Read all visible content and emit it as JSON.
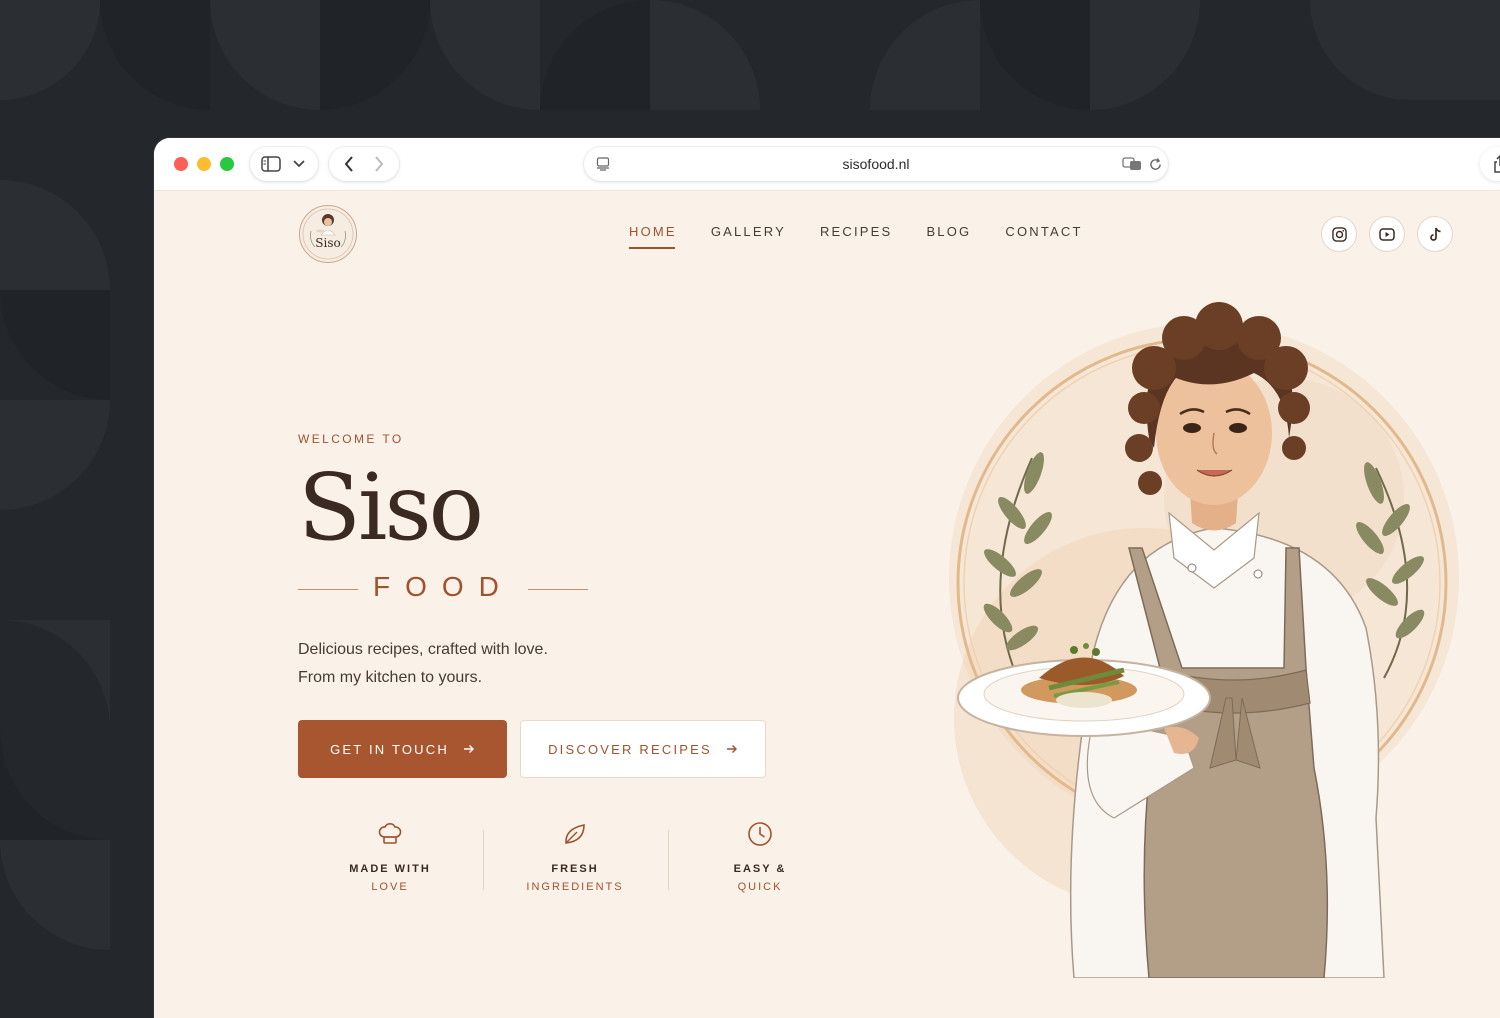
{
  "browser": {
    "url": "sisofood.nl"
  },
  "site": {
    "logo_text": "Siso",
    "nav": [
      {
        "label": "HOME",
        "active": true
      },
      {
        "label": "GALLERY",
        "active": false
      },
      {
        "label": "RECIPES",
        "active": false
      },
      {
        "label": "BLOG",
        "active": false
      },
      {
        "label": "CONTACT",
        "active": false
      }
    ],
    "social": [
      "instagram-icon",
      "youtube-icon",
      "tiktok-icon"
    ]
  },
  "hero": {
    "welcome": "WELCOME TO",
    "brand": "Siso",
    "subbrand": "FOOD",
    "tagline_1": "Delicious recipes, crafted with love.",
    "tagline_2": "From my kitchen to yours.",
    "primary_button": "GET IN TOUCH",
    "secondary_button": "DISCOVER RECIPES"
  },
  "features": [
    {
      "icon": "chef-hat-icon",
      "title": "MADE WITH",
      "sub": "LOVE"
    },
    {
      "icon": "leaf-icon",
      "title": "FRESH",
      "sub": "INGREDIENTS"
    },
    {
      "icon": "clock-icon",
      "title": "EASY &",
      "sub": "QUICK"
    }
  ],
  "colors": {
    "accent": "#a8562f",
    "page_bg": "#faf2e8",
    "text_dark": "#3a2a22",
    "outer_bg": "#24272b"
  }
}
